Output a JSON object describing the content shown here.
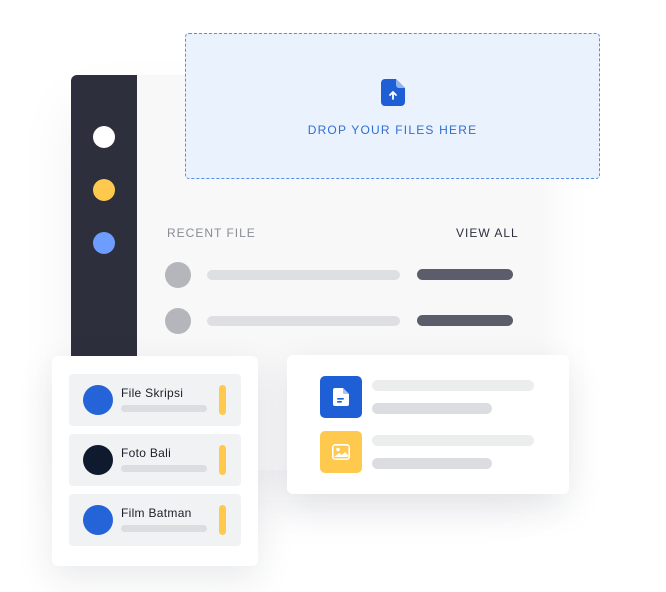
{
  "dropzone": {
    "label": "DROP YOUR FILES HERE",
    "icon": "file-upload-icon"
  },
  "recent": {
    "title": "RECENT FILE",
    "view_all": "VIEW ALL"
  },
  "sidebar": {
    "dots": [
      "#ffffff",
      "#ffc94d",
      "#6d9eff"
    ]
  },
  "files": [
    {
      "name": "File Skripsi",
      "color": "#2563d9"
    },
    {
      "name": "Foto Bali",
      "color": "#101a2f"
    },
    {
      "name": "Film Batman",
      "color": "#2563d9"
    }
  ],
  "media": [
    {
      "icon": "document-icon",
      "color": "#1f5fd6"
    },
    {
      "icon": "image-icon",
      "color": "#ffc94d"
    }
  ],
  "colors": {
    "accent_blue": "#2563d9",
    "accent_yellow": "#ffc94d",
    "sidebar_dark": "#2d2f3d"
  }
}
